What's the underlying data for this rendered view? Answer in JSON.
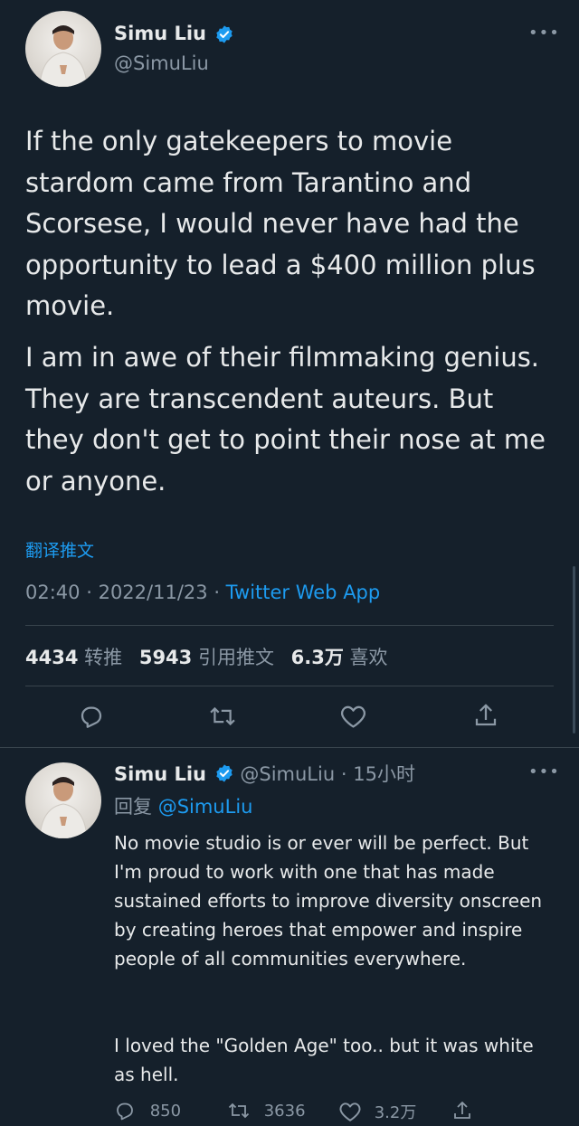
{
  "main_tweet": {
    "author_name": "Simu Liu",
    "author_handle": "@SimuLiu",
    "paragraph1": "If the only gatekeepers to movie stardom came from Tarantino and Scorsese, I would never have had the opportunity to lead a $400 million plus movie.",
    "paragraph2": "I am in awe of their filmmaking genius. They are transcendent auteurs. But they don't get to point their nose at me or anyone.",
    "translate_link": "翻译推文",
    "time": "02:40",
    "date": "2022/11/23",
    "source": "Twitter Web App",
    "stats": {
      "retweets_count": "4434",
      "retweets_label": "转推",
      "quotes_count": "5943",
      "quotes_label": "引用推文",
      "likes_count": "6.3万",
      "likes_label": "喜欢"
    }
  },
  "reply_tweet": {
    "author_name": "Simu Liu",
    "author_handle": "@SimuLiu",
    "age": "15小时",
    "reply_prefix": "回复",
    "reply_to": "@SimuLiu",
    "paragraph1": "No movie studio is or ever will be perfect. But I'm proud to work with one that has made sustained efforts to improve diversity onscreen by creating heroes that empower and inspire people of all communities everywhere.",
    "paragraph2": "I loved the \"Golden Age\" too.. but it was white as hell.",
    "replies": "850",
    "retweets": "3636",
    "likes": "3.2万"
  },
  "colors": {
    "background": "#15202b",
    "text": "#e7e9ea",
    "muted": "#8b98a5",
    "accent": "#1d9bf0",
    "divider": "#38444d"
  }
}
